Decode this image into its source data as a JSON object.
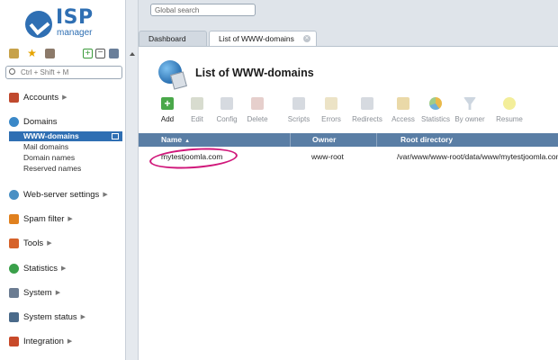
{
  "brand": {
    "logo_isp": "ISP",
    "logo_manager": "manager"
  },
  "sidebar": {
    "search_placeholder": "Ctrl + Shift + M",
    "items": [
      {
        "label": "Accounts",
        "icon": "accounts-icon"
      },
      {
        "label": "Domains",
        "icon": "domains-icon"
      },
      {
        "label": "Web-server settings",
        "icon": "webserver-icon"
      },
      {
        "label": "Spam filter",
        "icon": "spam-filter-icon"
      },
      {
        "label": "Tools",
        "icon": "tools-icon"
      },
      {
        "label": "Statistics",
        "icon": "statistics-icon"
      },
      {
        "label": "System",
        "icon": "system-icon"
      },
      {
        "label": "System status",
        "icon": "system-status-icon"
      },
      {
        "label": "Integration",
        "icon": "integration-icon"
      }
    ],
    "domains_sub": [
      {
        "label": "WWW-domains",
        "active": true
      },
      {
        "label": "Mail domains"
      },
      {
        "label": "Domain names"
      },
      {
        "label": "Reserved names"
      }
    ]
  },
  "topbar": {
    "search_placeholder": "Global search"
  },
  "tabs": [
    {
      "label": "Dashboard"
    },
    {
      "label": "List of WWW-domains"
    }
  ],
  "page": {
    "title": "List of WWW-domains"
  },
  "toolbar": [
    {
      "label": "Add",
      "enabled": true
    },
    {
      "label": "Edit"
    },
    {
      "label": "Config"
    },
    {
      "label": "Delete"
    },
    {
      "label": "Scripts"
    },
    {
      "label": "Errors"
    },
    {
      "label": "Redirects"
    },
    {
      "label": "Access"
    },
    {
      "label": "Statistics"
    },
    {
      "label": "By owner"
    },
    {
      "label": "Resume"
    }
  ],
  "table": {
    "columns": [
      "Name",
      "Owner",
      "Root directory"
    ],
    "rows": [
      {
        "name": "mytestjoomla.com",
        "owner": "www-root",
        "root": "/var/www/www-root/data/www/mytestjoomla.com"
      }
    ]
  },
  "colors": {
    "accent": "#2f6fb3",
    "table_header": "#5a7ea5",
    "highlight_circle": "#d0177a"
  }
}
